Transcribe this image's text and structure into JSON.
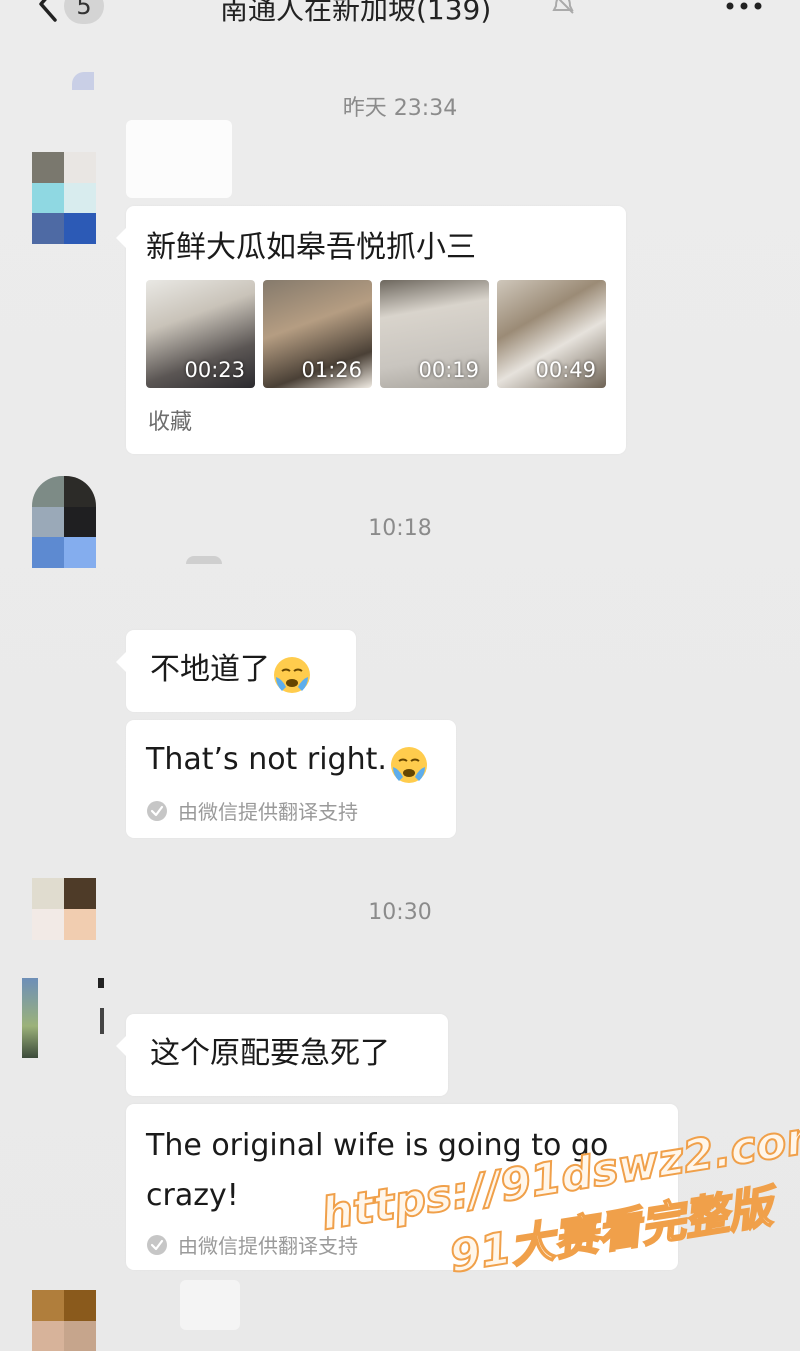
{
  "header": {
    "unread_count": "5",
    "title": "南通人在新加坡(139)"
  },
  "timestamps": [
    "昨天 23:34",
    "10:18",
    "10:30"
  ],
  "messages": [
    {
      "card": {
        "title": "新鲜大瓜如皋吾悦抓小三",
        "videos": [
          {
            "duration": "00:23"
          },
          {
            "duration": "01:26"
          },
          {
            "duration": "00:19"
          },
          {
            "duration": "00:49"
          }
        ],
        "footer": "收藏"
      }
    },
    {
      "text": "不地道了",
      "translation": "That’s not right.",
      "translation_note": "由微信提供翻译支持"
    },
    {
      "text": "这个原配要急死了",
      "translation_line1": "The original wife is going to go",
      "translation_line2": "crazy!",
      "translation_note": "由微信提供翻译支持"
    }
  ],
  "watermark": {
    "url": "https://91dswz2.com",
    "text": "91大赛看完整版"
  },
  "colors": {
    "background": "#ededed",
    "bubble": "#ffffff",
    "timestamp": "#8b8b8b",
    "watermark_stroke": "#f0a04a"
  }
}
